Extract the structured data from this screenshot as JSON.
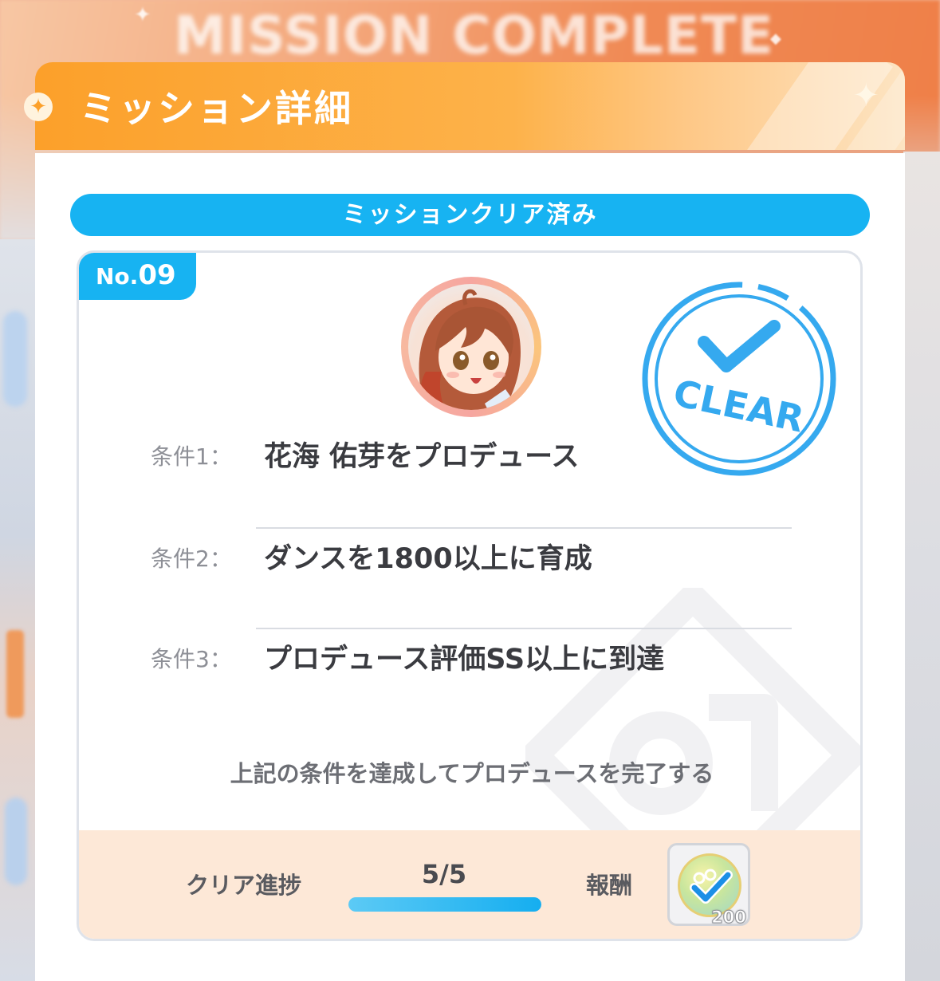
{
  "background": {
    "banner_text": "MISSION COMPLETE"
  },
  "dialog": {
    "title": "ミッション詳細",
    "status": "ミッションクリア済み",
    "accent_color": "#17b3f2",
    "header_color": "#fca02a"
  },
  "mission": {
    "number_prefix": "No.",
    "number": "09",
    "stamp_text": "CLEAR",
    "conditions": [
      {
        "label": "条件1：",
        "text": "花海 佑芽をプロデュース"
      },
      {
        "label": "条件2：",
        "text": "ダンスを1800以上に育成"
      },
      {
        "label": "条件3：",
        "text": "プロデュース評価SS以上に到達"
      }
    ],
    "footer_note": "上記の条件を達成してプロデュースを完了する"
  },
  "progress": {
    "label": "クリア進捗",
    "value_text": "5/5",
    "fraction": 1.0
  },
  "reward": {
    "label": "報酬",
    "icon": "check-coin-icon",
    "count": "200"
  }
}
